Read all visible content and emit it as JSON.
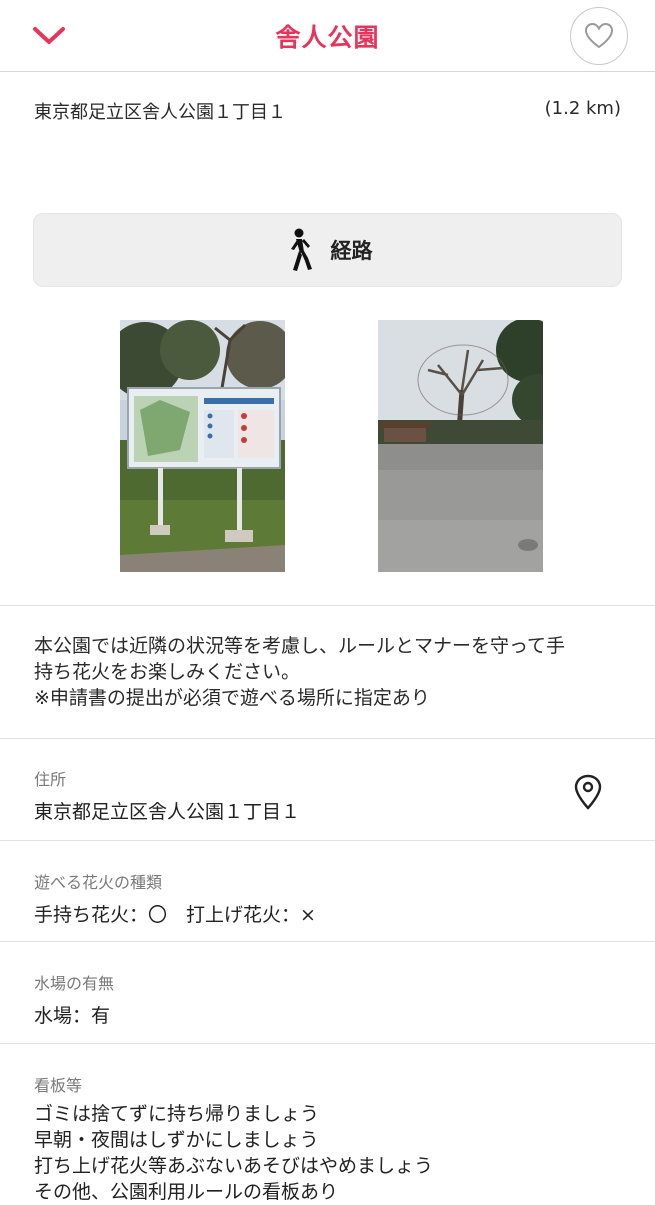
{
  "header": {
    "title": "舎人公園",
    "back_icon": "chevron-down-icon",
    "favorite_icon": "heart-outline-icon"
  },
  "colors": {
    "accent": "#e8345a",
    "muted_label": "#7a7a7a",
    "button_bg": "#efefef"
  },
  "summary": {
    "address": "東京都足立区舎人公園１丁目１",
    "distance": "(1.2 km)"
  },
  "route_button": {
    "label": "経路",
    "icon": "walking-person-icon"
  },
  "photos": [
    {
      "alt": "park-map-signboard"
    },
    {
      "alt": "park-plaza-trees"
    }
  ],
  "description": {
    "lines": [
      "本公園では近隣の状況等を考慮し、ルールとマナーを守って手",
      "持ち花火をお楽しみください。",
      "※申請書の提出が必須で遊べる場所に指定あり"
    ]
  },
  "address_section": {
    "label": "住所",
    "value": "東京都足立区舎人公園１丁目１",
    "icon": "map-pin-icon"
  },
  "fireworks_section": {
    "label": "遊べる花火の種類",
    "value": "手持ち花火：〇　打上げ花火：×"
  },
  "water_section": {
    "label": "水場の有無",
    "value": "水場：有"
  },
  "signs_section": {
    "label": "看板等",
    "lines": [
      "ゴミは捨てずに持ち帰りましょう",
      "早朝・夜間はしずかにしましょう",
      "打ち上げ花火等あぶないあそびはやめましょう",
      "その他、公園利用ルールの看板あり"
    ]
  }
}
